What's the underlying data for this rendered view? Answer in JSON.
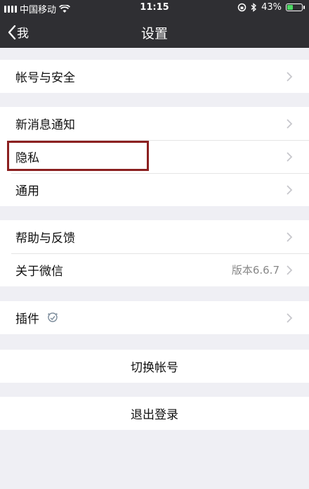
{
  "status_bar": {
    "carrier": "中国移动",
    "time": "11:15",
    "battery": "43%",
    "battery_level": 0.43
  },
  "nav": {
    "back_label": "我",
    "title": "设置"
  },
  "groups": {
    "account": {
      "label": "帐号与安全"
    },
    "notify": {
      "label": "新消息通知"
    },
    "privacy": {
      "label": "隐私"
    },
    "general": {
      "label": "通用"
    },
    "help": {
      "label": "帮助与反馈"
    },
    "about": {
      "label": "关于微信",
      "value": "版本6.6.7"
    },
    "plugins": {
      "label": "插件"
    },
    "switch_account": {
      "label": "切换帐号"
    },
    "logout": {
      "label": "退出登录"
    }
  },
  "colors": {
    "nav_background": "#2f2f33",
    "page_background": "#efeff4",
    "highlight_border": "#8b2020",
    "battery_fill": "#4cd964"
  }
}
